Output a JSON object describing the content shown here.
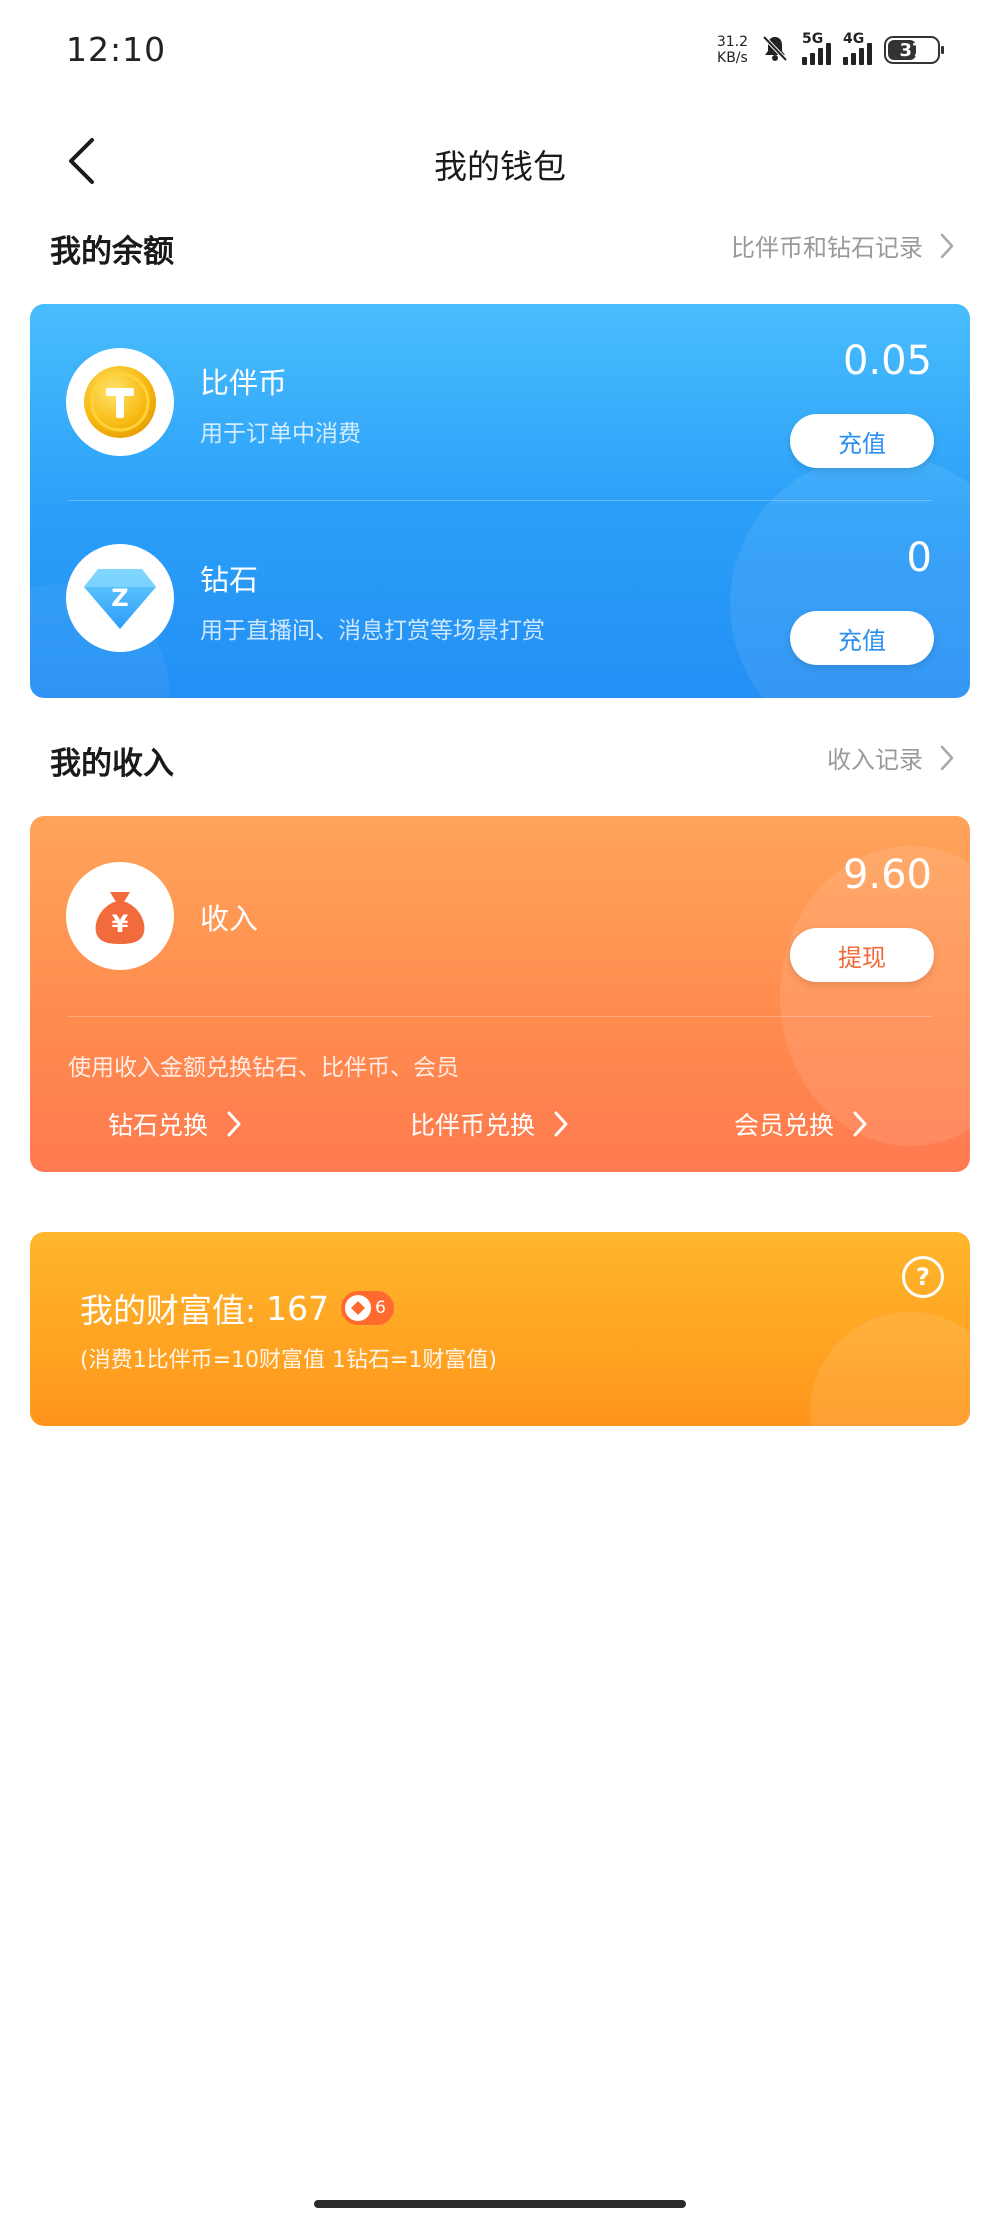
{
  "status_bar": {
    "time": "12:10",
    "net_speed_value": "31.2",
    "net_speed_unit": "KB/s",
    "signal1_label": "5G",
    "signal2_label": "4G",
    "battery": "37",
    "icons": [
      "bell-muted-icon",
      "signal-icon",
      "signal-icon",
      "battery-icon"
    ]
  },
  "header": {
    "title": "我的钱包",
    "back_icon": "chevron-left-icon"
  },
  "balance_section": {
    "title": "我的余额",
    "link_label": "比伴币和钻石记录",
    "items": [
      {
        "name": "比伴币",
        "desc": "用于订单中消费",
        "amount": "0.05",
        "button": "充值",
        "icon": "coin-icon"
      },
      {
        "name": "钻石",
        "desc": "用于直播间、消息打赏等场景打赏",
        "amount": "0",
        "button": "充值",
        "icon": "diamond-icon"
      }
    ],
    "colors": {
      "card_start": "#49bdfc",
      "card_end": "#248ff5",
      "button_text": "#2b8ff0"
    }
  },
  "income_section": {
    "title": "我的收入",
    "link_label": "收入记录",
    "item": {
      "name": "收入",
      "amount": "9.60",
      "button": "提现",
      "icon": "money-bag-icon",
      "icon_glyph": "¥"
    },
    "note": "使用收入金额兑换钻石、比伴币、会员",
    "exchanges": [
      "钻石兑换",
      "比伴币兑换",
      "会员兑换"
    ],
    "colors": {
      "card_start": "#ffa45a",
      "card_end": "#ff7a50",
      "button_text": "#f06a3a"
    }
  },
  "wealth_section": {
    "label": "我的财富值:",
    "value": "167",
    "level": "6",
    "note": "(消费1比伴币=10财富值 1钻石=1财富值)",
    "help_glyph": "?",
    "colors": {
      "card_start": "#ffb62c",
      "card_end": "#ff951c",
      "badge": "#ff6a2e"
    }
  }
}
